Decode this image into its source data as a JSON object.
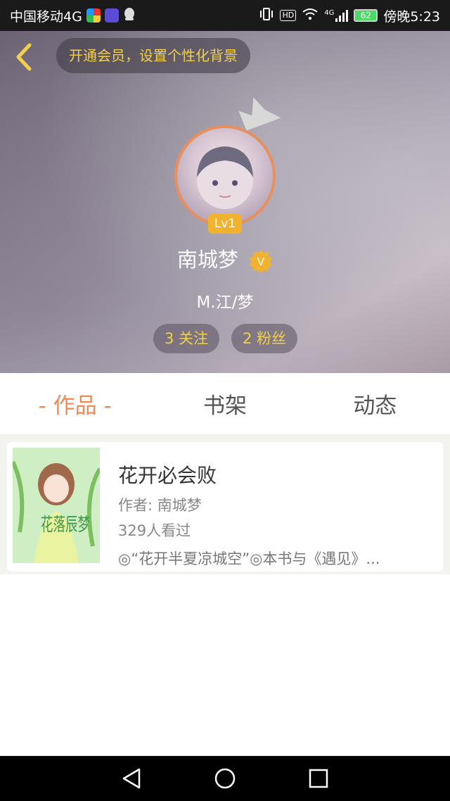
{
  "status_bar": {
    "carrier": "中国移动4G",
    "hd_label": "HD",
    "network_label": "4G",
    "battery": "62",
    "time": "傍晚5:23"
  },
  "header": {
    "vip_prompt": "开通会员，设置个性化背景",
    "level_badge": "Lv1",
    "username": "南城梦",
    "verified_badge": "V",
    "signature": "M.江/梦",
    "follow_label": "3 关注",
    "fans_label": "2 粉丝"
  },
  "tabs": [
    {
      "label": "- 作品 -",
      "active": true
    },
    {
      "label": "书架",
      "active": false
    },
    {
      "label": "动态",
      "active": false
    }
  ],
  "books": [
    {
      "title": "花开必会败",
      "author": "作者: 南城梦",
      "views": "329人看过",
      "description": "◎“花开半夏凉城空”◎本书与《遇见》...",
      "cover_text": "花落辰梦"
    }
  ],
  "colors": {
    "accent": "#ee8a56",
    "gold": "#f2d04a",
    "status_bar": "#1a1a1a",
    "nav_bar": "#000000"
  },
  "icons": [
    "back-arrow-icon",
    "crown-icon",
    "verified-icon",
    "nav-back-icon",
    "nav-home-icon",
    "nav-recents-icon"
  ]
}
